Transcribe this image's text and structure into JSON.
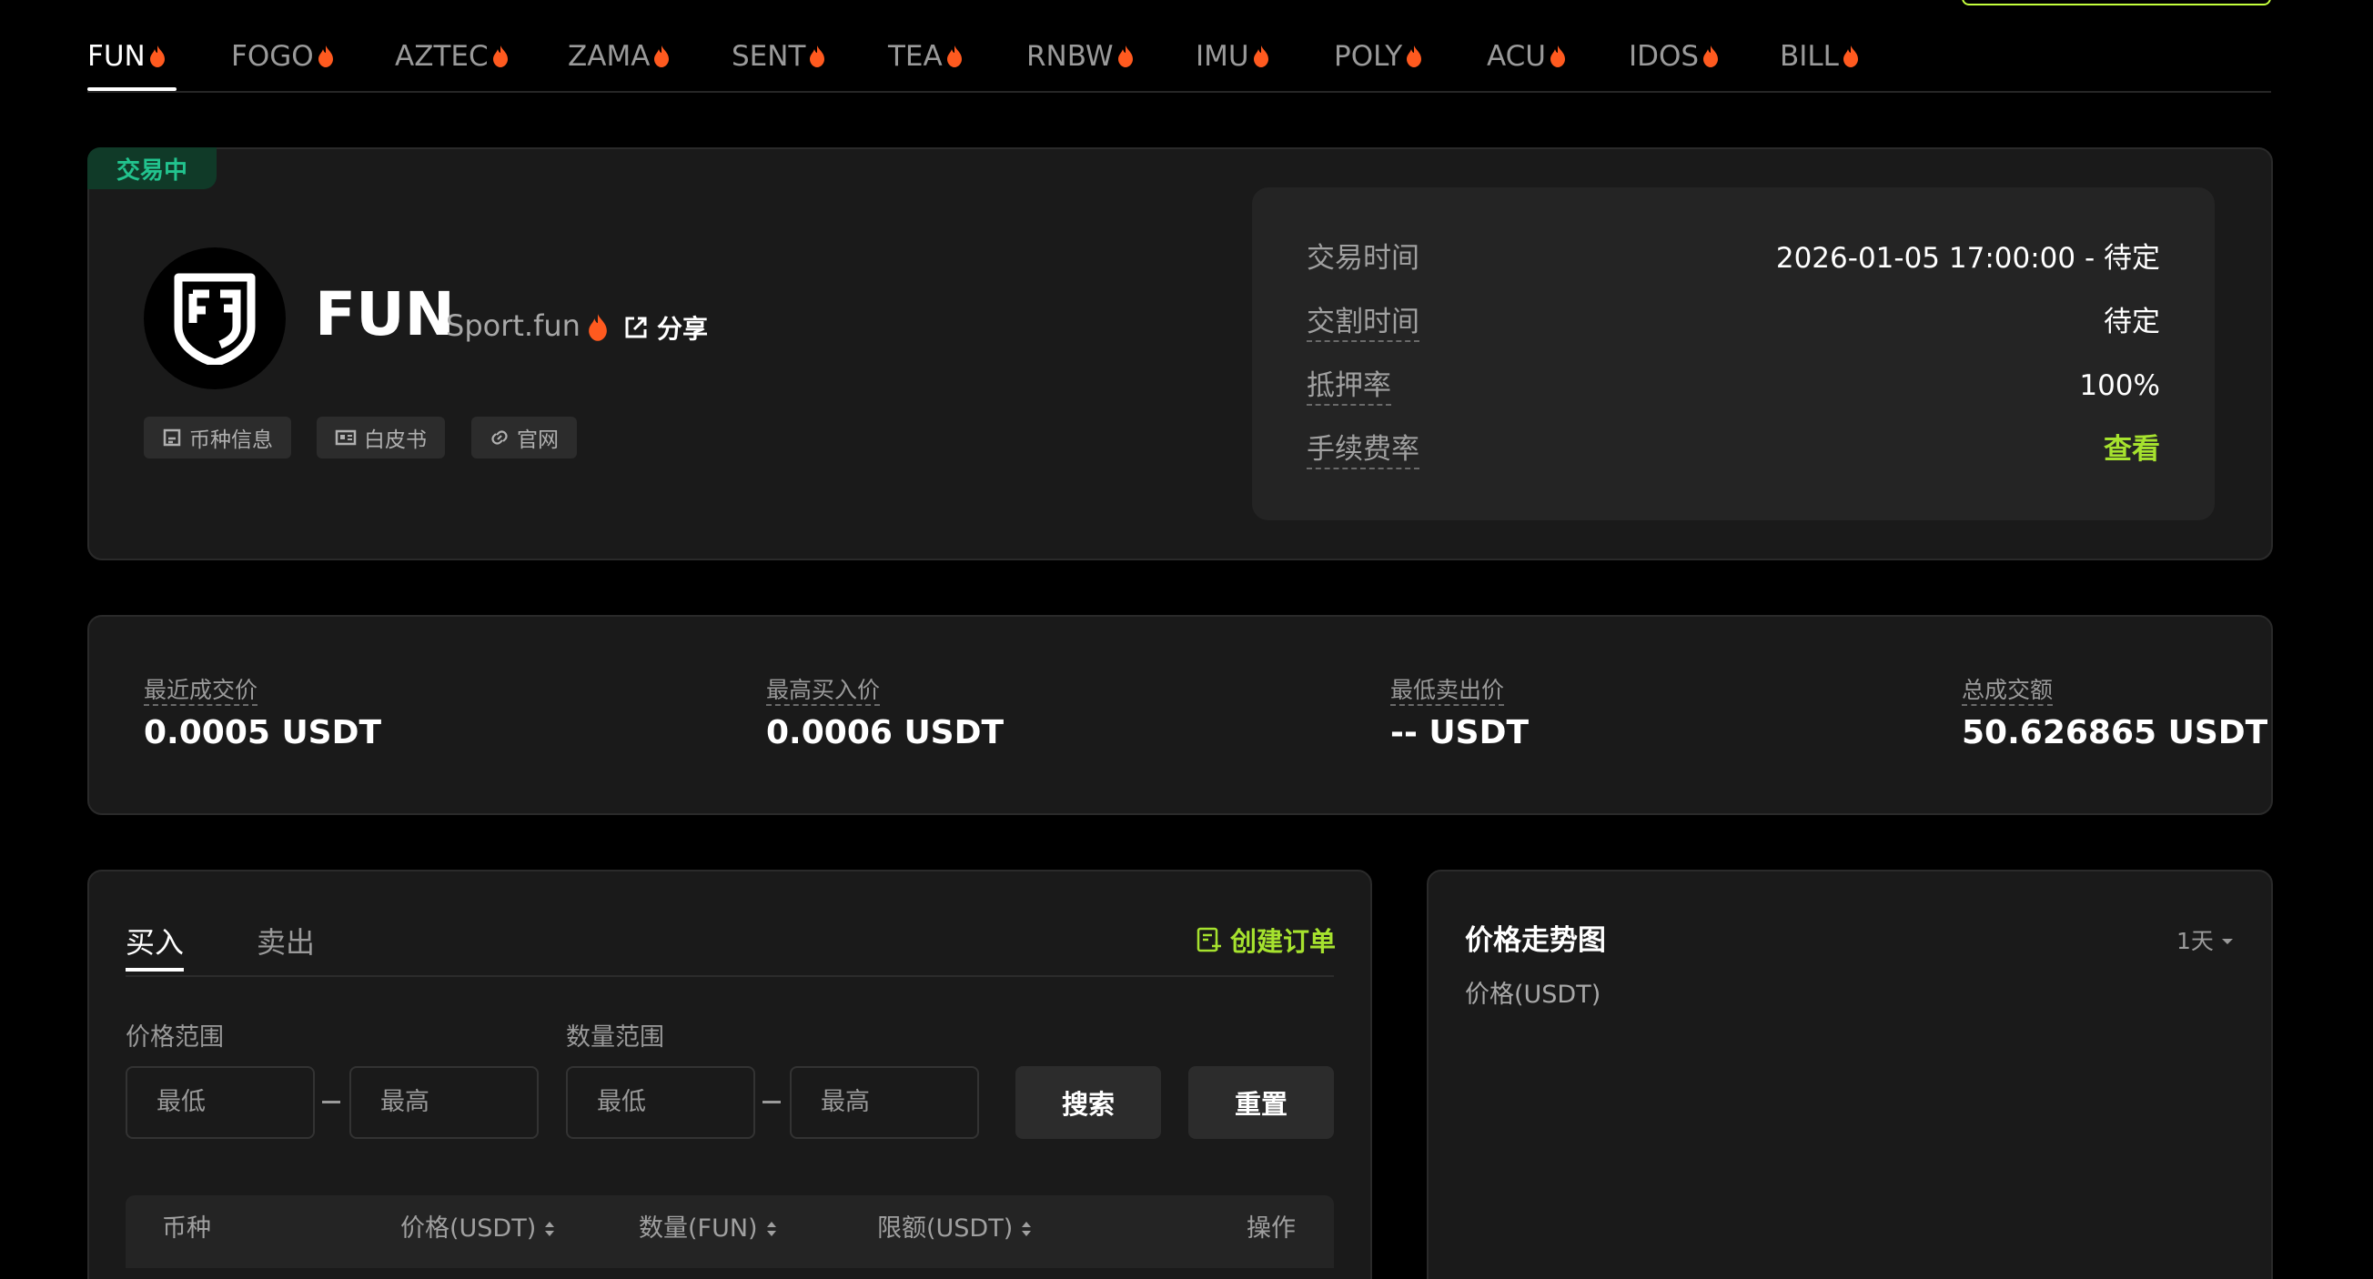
{
  "tabs": [
    {
      "label": "FUN",
      "active": true
    },
    {
      "label": "FOGO",
      "active": false
    },
    {
      "label": "AZTEC",
      "active": false
    },
    {
      "label": "ZAMA",
      "active": false
    },
    {
      "label": "SENT",
      "active": false
    },
    {
      "label": "TEA",
      "active": false
    },
    {
      "label": "RNBW",
      "active": false
    },
    {
      "label": "IMU",
      "active": false
    },
    {
      "label": "POLY",
      "active": false
    },
    {
      "label": "ACU",
      "active": false
    },
    {
      "label": "IDOS",
      "active": false
    },
    {
      "label": "BILL",
      "active": false
    }
  ],
  "token": {
    "status": "交易中",
    "symbol": "FUN",
    "name": "Sport.fun",
    "share_label": "分享",
    "links": [
      {
        "label": "币种信息",
        "icon": "document-icon"
      },
      {
        "label": "白皮书",
        "icon": "id-card-icon"
      },
      {
        "label": "官网",
        "icon": "link-icon"
      }
    ]
  },
  "trade_info": [
    {
      "label": "交易时间",
      "value": "2026-01-05 17:00:00 - 待定"
    },
    {
      "label": "交割时间",
      "value": "待定"
    },
    {
      "label": "抵押率",
      "value": "100%"
    },
    {
      "label": "手续费率",
      "value": "查看"
    }
  ],
  "stats": [
    {
      "label": "最近成交价",
      "value": "0.0005 USDT"
    },
    {
      "label": "最高买入价",
      "value": "0.0006 USDT"
    },
    {
      "label": "最低卖出价",
      "value": "-- USDT"
    },
    {
      "label": "总成交额",
      "value": "50.626865 USDT"
    }
  ],
  "orders": {
    "buy_tab": "买入",
    "sell_tab": "卖出",
    "create_order": "创建订单",
    "price_range_label": "价格范围",
    "qty_range_label": "数量范围",
    "min_placeholder": "最低",
    "max_placeholder": "最高",
    "search_label": "搜索",
    "reset_label": "重置",
    "columns": [
      "币种",
      "价格(USDT)",
      "数量(FUN)",
      "限额(USDT)",
      "操作"
    ]
  },
  "chart": {
    "title": "价格走势图",
    "range": "1天",
    "ylabel": "价格(USDT)"
  },
  "colors": {
    "accent_green": "#a6e22e",
    "status_green": "#22c38e",
    "flame": "#ff5a1f"
  }
}
